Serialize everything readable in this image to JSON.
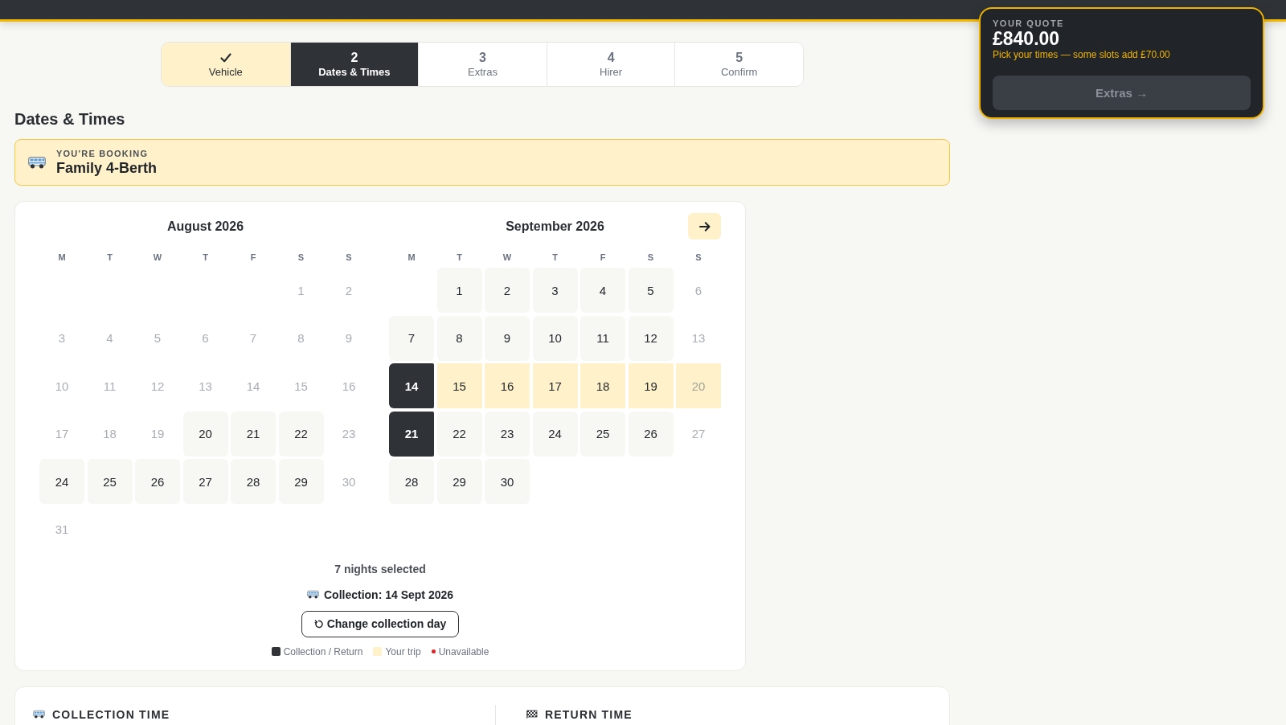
{
  "quote": {
    "label": "YOUR QUOTE",
    "amount": "£840.00",
    "note": "Pick your times — some slots add £70.00",
    "button": {
      "label": "Extras →",
      "disabled": true
    }
  },
  "steps": [
    {
      "label": "Vehicle",
      "done": true,
      "selected": false
    },
    {
      "number": "2",
      "label": "Dates & Times",
      "done": false,
      "selected": true
    },
    {
      "number": "3",
      "label": "Extras",
      "done": false,
      "selected": false
    },
    {
      "number": "4",
      "label": "Hirer",
      "done": false,
      "selected": false
    },
    {
      "number": "5",
      "label": "Confirm",
      "done": false,
      "selected": false
    }
  ],
  "heading": "Dates & Times",
  "booking": {
    "label": "YOU'RE BOOKING",
    "vehicle": "Family 4-Berth"
  },
  "calendar": {
    "months": [
      {
        "title": "August 2026",
        "weekdays": [
          "M",
          "T",
          "W",
          "T",
          "F",
          "S",
          "S"
        ],
        "days": [
          {
            "kind": "empty"
          },
          {
            "kind": "empty"
          },
          {
            "kind": "empty"
          },
          {
            "kind": "empty"
          },
          {
            "kind": "empty"
          },
          {
            "kind": "day",
            "label": "1",
            "available": false,
            "selected": false,
            "in_trip": false
          },
          {
            "kind": "day",
            "label": "2",
            "available": false,
            "selected": false,
            "in_trip": false
          },
          {
            "kind": "day",
            "label": "3",
            "available": false,
            "selected": false,
            "in_trip": false
          },
          {
            "kind": "day",
            "label": "4",
            "available": false,
            "selected": false,
            "in_trip": false
          },
          {
            "kind": "day",
            "label": "5",
            "available": false,
            "selected": false,
            "in_trip": false
          },
          {
            "kind": "day",
            "label": "6",
            "available": false,
            "selected": false,
            "in_trip": false
          },
          {
            "kind": "day",
            "label": "7",
            "available": false,
            "selected": false,
            "in_trip": false
          },
          {
            "kind": "day",
            "label": "8",
            "available": false,
            "selected": false,
            "in_trip": false
          },
          {
            "kind": "day",
            "label": "9",
            "available": false,
            "selected": false,
            "in_trip": false
          },
          {
            "kind": "day",
            "label": "10",
            "available": false,
            "selected": false,
            "in_trip": false
          },
          {
            "kind": "day",
            "label": "11",
            "available": false,
            "selected": false,
            "in_trip": false
          },
          {
            "kind": "day",
            "label": "12",
            "available": false,
            "selected": false,
            "in_trip": false
          },
          {
            "kind": "day",
            "label": "13",
            "available": false,
            "selected": false,
            "in_trip": false
          },
          {
            "kind": "day",
            "label": "14",
            "available": false,
            "selected": false,
            "in_trip": false
          },
          {
            "kind": "day",
            "label": "15",
            "available": false,
            "selected": false,
            "in_trip": false
          },
          {
            "kind": "day",
            "label": "16",
            "available": false,
            "selected": false,
            "in_trip": false
          },
          {
            "kind": "day",
            "label": "17",
            "available": false,
            "selected": false,
            "in_trip": false
          },
          {
            "kind": "day",
            "label": "18",
            "available": false,
            "selected": false,
            "in_trip": false
          },
          {
            "kind": "day",
            "label": "19",
            "available": false,
            "selected": false,
            "in_trip": false
          },
          {
            "kind": "day",
            "label": "20",
            "available": true,
            "selected": false,
            "in_trip": false
          },
          {
            "kind": "day",
            "label": "21",
            "available": true,
            "selected": false,
            "in_trip": false
          },
          {
            "kind": "day",
            "label": "22",
            "available": true,
            "selected": false,
            "in_trip": false
          },
          {
            "kind": "day",
            "label": "23",
            "available": false,
            "selected": false,
            "in_trip": false
          },
          {
            "kind": "day",
            "label": "24",
            "available": true,
            "selected": false,
            "in_trip": false
          },
          {
            "kind": "day",
            "label": "25",
            "available": true,
            "selected": false,
            "in_trip": false
          },
          {
            "kind": "day",
            "label": "26",
            "available": true,
            "selected": false,
            "in_trip": false
          },
          {
            "kind": "day",
            "label": "27",
            "available": true,
            "selected": false,
            "in_trip": false
          },
          {
            "kind": "day",
            "label": "28",
            "available": true,
            "selected": false,
            "in_trip": false
          },
          {
            "kind": "day",
            "label": "29",
            "available": true,
            "selected": false,
            "in_trip": false
          },
          {
            "kind": "day",
            "label": "30",
            "available": false,
            "selected": false,
            "in_trip": false
          },
          {
            "kind": "day",
            "label": "31",
            "available": false,
            "selected": false,
            "in_trip": false
          }
        ]
      },
      {
        "title": "September 2026",
        "next_button": true,
        "weekdays": [
          "M",
          "T",
          "W",
          "T",
          "F",
          "S",
          "S"
        ],
        "days": [
          {
            "kind": "empty"
          },
          {
            "kind": "day",
            "label": "1",
            "available": true,
            "selected": false,
            "in_trip": false
          },
          {
            "kind": "day",
            "label": "2",
            "available": true,
            "selected": false,
            "in_trip": false
          },
          {
            "kind": "day",
            "label": "3",
            "available": true,
            "selected": false,
            "in_trip": false
          },
          {
            "kind": "day",
            "label": "4",
            "available": true,
            "selected": false,
            "in_trip": false
          },
          {
            "kind": "day",
            "label": "5",
            "available": true,
            "selected": false,
            "in_trip": false
          },
          {
            "kind": "day",
            "label": "6",
            "available": false,
            "selected": false,
            "in_trip": false
          },
          {
            "kind": "day",
            "label": "7",
            "available": true,
            "selected": false,
            "in_trip": false
          },
          {
            "kind": "day",
            "label": "8",
            "available": true,
            "selected": false,
            "in_trip": false
          },
          {
            "kind": "day",
            "label": "9",
            "available": true,
            "selected": false,
            "in_trip": false
          },
          {
            "kind": "day",
            "label": "10",
            "available": true,
            "selected": false,
            "in_trip": false
          },
          {
            "kind": "day",
            "label": "11",
            "available": true,
            "selected": false,
            "in_trip": false
          },
          {
            "kind": "day",
            "label": "12",
            "available": true,
            "selected": false,
            "in_trip": false
          },
          {
            "kind": "day",
            "label": "13",
            "available": false,
            "selected": false,
            "in_trip": false
          },
          {
            "kind": "day",
            "label": "14",
            "available": true,
            "selected": true,
            "in_trip": false
          },
          {
            "kind": "day",
            "label": "15",
            "available": true,
            "selected": false,
            "in_trip": true
          },
          {
            "kind": "day",
            "label": "16",
            "available": true,
            "selected": false,
            "in_trip": true
          },
          {
            "kind": "day",
            "label": "17",
            "available": true,
            "selected": false,
            "in_trip": true
          },
          {
            "kind": "day",
            "label": "18",
            "available": true,
            "selected": false,
            "in_trip": true
          },
          {
            "kind": "day",
            "label": "19",
            "available": true,
            "selected": false,
            "in_trip": true
          },
          {
            "kind": "day",
            "label": "20",
            "available": false,
            "selected": false,
            "in_trip": true
          },
          {
            "kind": "day",
            "label": "21",
            "available": true,
            "selected": true,
            "in_trip": false
          },
          {
            "kind": "day",
            "label": "22",
            "available": true,
            "selected": false,
            "in_trip": false
          },
          {
            "kind": "day",
            "label": "23",
            "available": true,
            "selected": false,
            "in_trip": false
          },
          {
            "kind": "day",
            "label": "24",
            "available": true,
            "selected": false,
            "in_trip": false
          },
          {
            "kind": "day",
            "label": "25",
            "available": true,
            "selected": false,
            "in_trip": false
          },
          {
            "kind": "day",
            "label": "26",
            "available": true,
            "selected": false,
            "in_trip": false
          },
          {
            "kind": "day",
            "label": "27",
            "available": false,
            "selected": false,
            "in_trip": false
          },
          {
            "kind": "day",
            "label": "28",
            "available": true,
            "selected": false,
            "in_trip": false
          },
          {
            "kind": "day",
            "label": "29",
            "available": true,
            "selected": false,
            "in_trip": false
          },
          {
            "kind": "day",
            "label": "30",
            "available": true,
            "selected": false,
            "in_trip": false
          }
        ]
      }
    ],
    "nights": "7 nights selected",
    "collection": "Collection: 14 Sept 2026",
    "change_button": "Change collection day",
    "legend": [
      {
        "kind": "swatch",
        "label": "Collection / Return",
        "color": "#2f3337"
      },
      {
        "kind": "swatch",
        "label": "Your trip",
        "color": "#fff1c9"
      },
      {
        "kind": "dot",
        "label": "Unavailable",
        "color": "#e02424"
      }
    ]
  },
  "times": [
    {
      "kind": "collection",
      "title": "COLLECTION TIME"
    },
    {
      "kind": "return",
      "title": "RETURN TIME"
    }
  ]
}
